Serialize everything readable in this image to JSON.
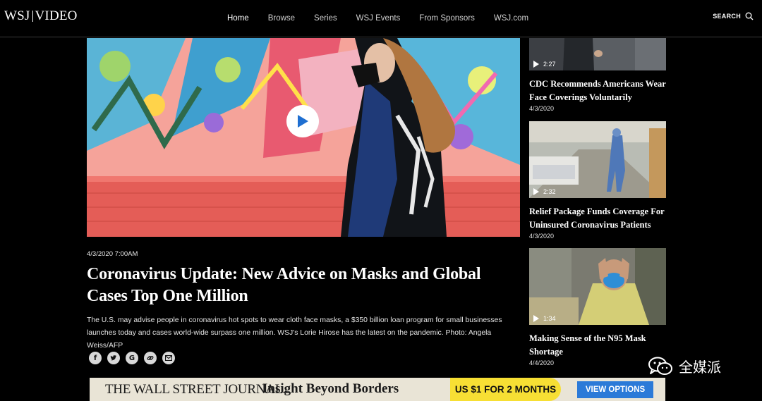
{
  "brand": {
    "logo_left": "WSJ",
    "logo_right": "VIDEO"
  },
  "nav": {
    "items": [
      {
        "label": "Home",
        "active": true
      },
      {
        "label": "Browse",
        "active": false
      },
      {
        "label": "Series",
        "active": false
      },
      {
        "label": "WSJ Events",
        "active": false
      },
      {
        "label": "From Sponsors",
        "active": false
      },
      {
        "label": "WSJ.com",
        "active": false
      }
    ],
    "search_label": "SEARCH"
  },
  "main": {
    "date": "4/3/2020 7:00AM",
    "headline": "Coronavirus Update: New Advice on Masks and Global Cases Top One Million",
    "description": "The U.S. may advise people in coronavirus hot spots to wear cloth face masks, a $350 billion loan program for small businesses launches today and cases world-wide surpass one million. WSJ's Lorie Hirose has the latest on the pandemic. Photo: Angela Weiss/AFP",
    "share_icons": [
      "facebook-icon",
      "twitter-icon",
      "google-icon",
      "link-icon",
      "email-icon"
    ]
  },
  "sidebar": {
    "items": [
      {
        "duration": "2:27",
        "title": "CDC Recommends Americans Wear Face Coverings Voluntarily",
        "date": "4/3/2020"
      },
      {
        "duration": "2:32",
        "title": "Relief Package Funds Coverage For Uninsured Coronavirus Patients",
        "date": "4/3/2020"
      },
      {
        "duration": "1:34",
        "title": "Making Sense of the N95 Mask Shortage",
        "date": "4/4/2020"
      }
    ]
  },
  "banner": {
    "publication": "THE WALL STREET JOURNAL.",
    "tagline": "Insight Beyond Borders",
    "offer": "US $1 FOR 2 MONTHS",
    "cta": "VIEW OPTIONS"
  },
  "watermark": {
    "text": "全媒派"
  },
  "colors": {
    "background": "#000000",
    "offer_yellow": "#f7df34",
    "cta_blue": "#2b7ad8",
    "play_blue": "#1f6fd1"
  }
}
